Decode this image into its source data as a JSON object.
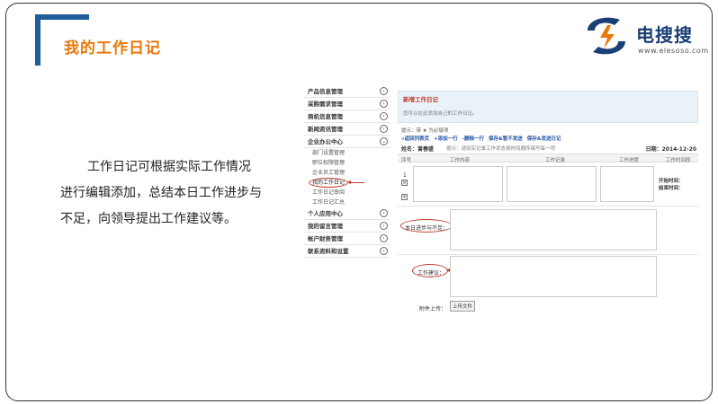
{
  "slide": {
    "title": "我的工作日记",
    "logo_text": "电搜搜",
    "logo_url": "www.elesoso.com",
    "body_lines": [
      "工作日记可根据实际工作情况",
      "进行编辑添加，总结本日工作进步与",
      "不足，向领导提出工作建议等。"
    ]
  },
  "sidebar": {
    "items": [
      {
        "label": "产品信息管理",
        "arrow": "›"
      },
      {
        "label": "采购需求管理",
        "arrow": "›"
      },
      {
        "label": "商机信息管理",
        "arrow": "›"
      },
      {
        "label": "新闻资讯管理",
        "arrow": "›"
      },
      {
        "label": "企业办公中心",
        "arrow": "⌄"
      }
    ],
    "subitems": [
      "部门设置管理",
      "职位权限管理",
      "企业员工管理",
      "我的工作日记",
      "工作日记审阅",
      "工作日记汇总"
    ],
    "items2": [
      {
        "label": "个人应用中心",
        "arrow": "›"
      },
      {
        "label": "我的留言管理",
        "arrow": "›"
      },
      {
        "label": "帐户财务管理",
        "arrow": "›"
      },
      {
        "label": "联系资料和设置",
        "arrow": "›"
      }
    ]
  },
  "form": {
    "panel_title": "新增工作日记",
    "panel_desc": "您可以在此添加自己的工作日记。",
    "hint": "提示：带 ★ 为必填项",
    "toolbar": [
      "«返回列表页",
      "+添加一行",
      "-删除一行",
      "保存&暂不发送",
      "保存&发送日记"
    ],
    "name_label": "姓名：曾春盛",
    "tip": "提示：请如实记录工作状态按时间顺序填写每一项",
    "date": "日期：2014-12-20",
    "columns": [
      "序号",
      "工作内容",
      "工作记录",
      "工作进度",
      "工作时间段"
    ],
    "row_no": "1",
    "start_time": "开始时间：",
    "end_time": "结束时间：",
    "progress_label": "本日进步与不足：",
    "suggest_label": "工作建议：",
    "attach_label": "附件上传：",
    "upload_btn": "上传文件"
  },
  "colors": {
    "accent": "#e8790a",
    "brand": "#1f5c99",
    "annotation": "#c0392b"
  }
}
